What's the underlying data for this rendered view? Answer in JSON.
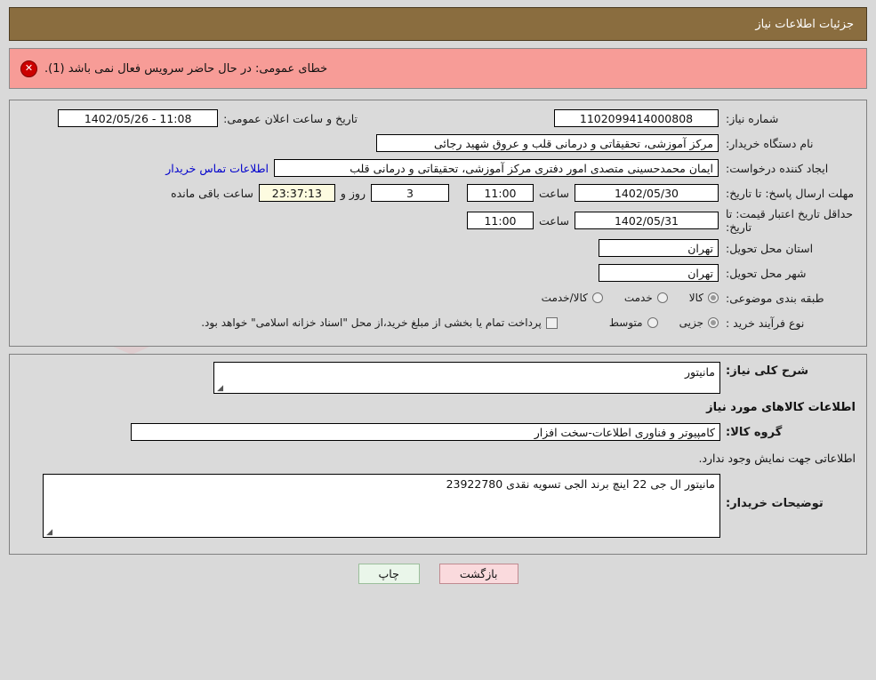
{
  "window": {
    "title": "جزئیات اطلاعات نیاز"
  },
  "alert": {
    "icon": "error-circle-icon",
    "message": "خطای عمومی: در حال حاضر سرویس فعال نمی باشد (1).",
    "bg_color": "#f79c97",
    "icon_color": "#cc0000"
  },
  "details": {
    "need_number_label": "شماره نیاز:",
    "need_number_value": "1102099414000808",
    "announce_label": "تاریخ و ساعت اعلان عمومی:",
    "announce_value": "11:08 - 1402/05/26",
    "buyer_org_label": "نام دستگاه خریدار:",
    "buyer_org_value": "مرکز آموزشی، تحقیقاتی و درمانی قلب و عروق شهید رجائی",
    "creator_label": "ایجاد کننده درخواست:",
    "creator_value": "ایمان محمدحسینی متصدی امور دفتری مرکز آموزشی، تحقیقاتی و درمانی قلب",
    "contact_link": "اطلاعات تماس خریدار",
    "deadline_label": "مهلت ارسال پاسخ: تا تاریخ:",
    "deadline_date": "1402/05/30",
    "deadline_hour_label": "ساعت",
    "deadline_hour": "11:00",
    "remaining_days": "3",
    "remaining_days_label": "روز و",
    "remaining_clock": "23:37:13",
    "remaining_suffix": "ساعت باقی مانده",
    "validity_label": "حداقل تاریخ اعتبار قیمت: تا تاریخ:",
    "validity_date": "1402/05/31",
    "validity_hour_label": "ساعت",
    "validity_hour": "11:00",
    "province_label": "استان محل تحویل:",
    "province_value": "تهران",
    "city_label": "شهر محل تحویل:",
    "city_value": "تهران",
    "category_label": "طبقه بندی موضوعی:",
    "category_options": [
      {
        "label": "کالا",
        "selected": true
      },
      {
        "label": "خدمت",
        "selected": false
      },
      {
        "label": "کالا/خدمت",
        "selected": false
      }
    ],
    "process_label": "نوع فرآیند خرید :",
    "process_options": [
      {
        "label": "جزیی",
        "selected": true
      },
      {
        "label": "متوسط",
        "selected": false
      }
    ],
    "treasury_checkbox_label": "پرداخت تمام یا بخشی از مبلغ خرید،از محل \"اسناد خزانه اسلامی\" خواهد بود.",
    "treasury_checked": false
  },
  "requirement": {
    "summary_label": "شرح کلی نیاز:",
    "summary_value": "مانیتور",
    "goods_section_title": "اطلاعات کالاهای مورد نیاز",
    "goods_group_label": "گروه کالا:",
    "goods_group_value": "کامپیوتر و فناوری اطلاعات-سخت افزار",
    "empty_note": "اطلاعاتی جهت نمایش وجود ندارد.",
    "buyer_notes_label": "توضیحات خریدار:",
    "buyer_notes_value": "مانیتور ال جی 22 اینچ برند الجی تسویه نقدی 23922780"
  },
  "footer": {
    "print_button": "چاپ",
    "back_button": "بازگشت"
  },
  "watermark": {
    "text": "AriaTender.net"
  }
}
